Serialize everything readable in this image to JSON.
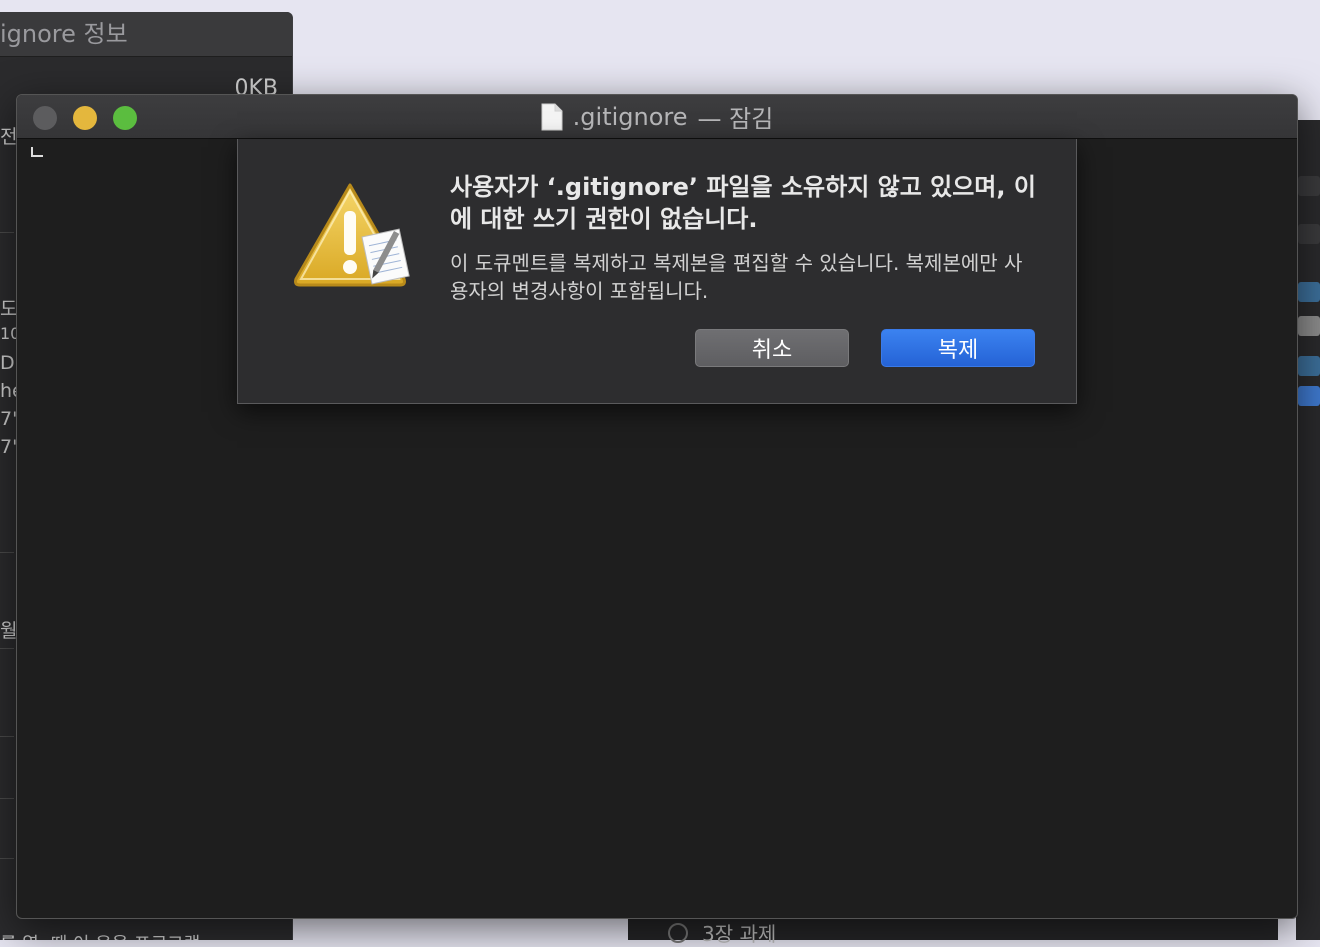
{
  "background": {
    "info_panel": {
      "title": "ignore 정보",
      "size": "0KB",
      "fragments": [
        "전",
        "도",
        "10",
        "D",
        "he",
        "7'",
        "7'",
        "월"
      ],
      "bottom_text": "를 열: 때 이 응용 프로그램"
    },
    "bottom_item_label": "3장 과제"
  },
  "window": {
    "title": ".gitignore",
    "title_suffix": "— 잠김"
  },
  "alert": {
    "title": "사용자가 ‘.gitignore’ 파일을 소유하지 않고 있으며, 이에 대한 쓰기 권한이 없습니다.",
    "body": "이 도큐멘트를 복제하고 복제본을 편집할 수 있습니다. 복제본에만 사용자의 변경사항이 포함됩니다.",
    "cancel_label": "취소",
    "duplicate_label": "복제",
    "icon": "warning-triangle-icon"
  },
  "colors": {
    "accent": "#2f6fe4",
    "close": "#5c5c5e",
    "minimize": "#e4b73d",
    "maximize": "#5bbd3f"
  }
}
